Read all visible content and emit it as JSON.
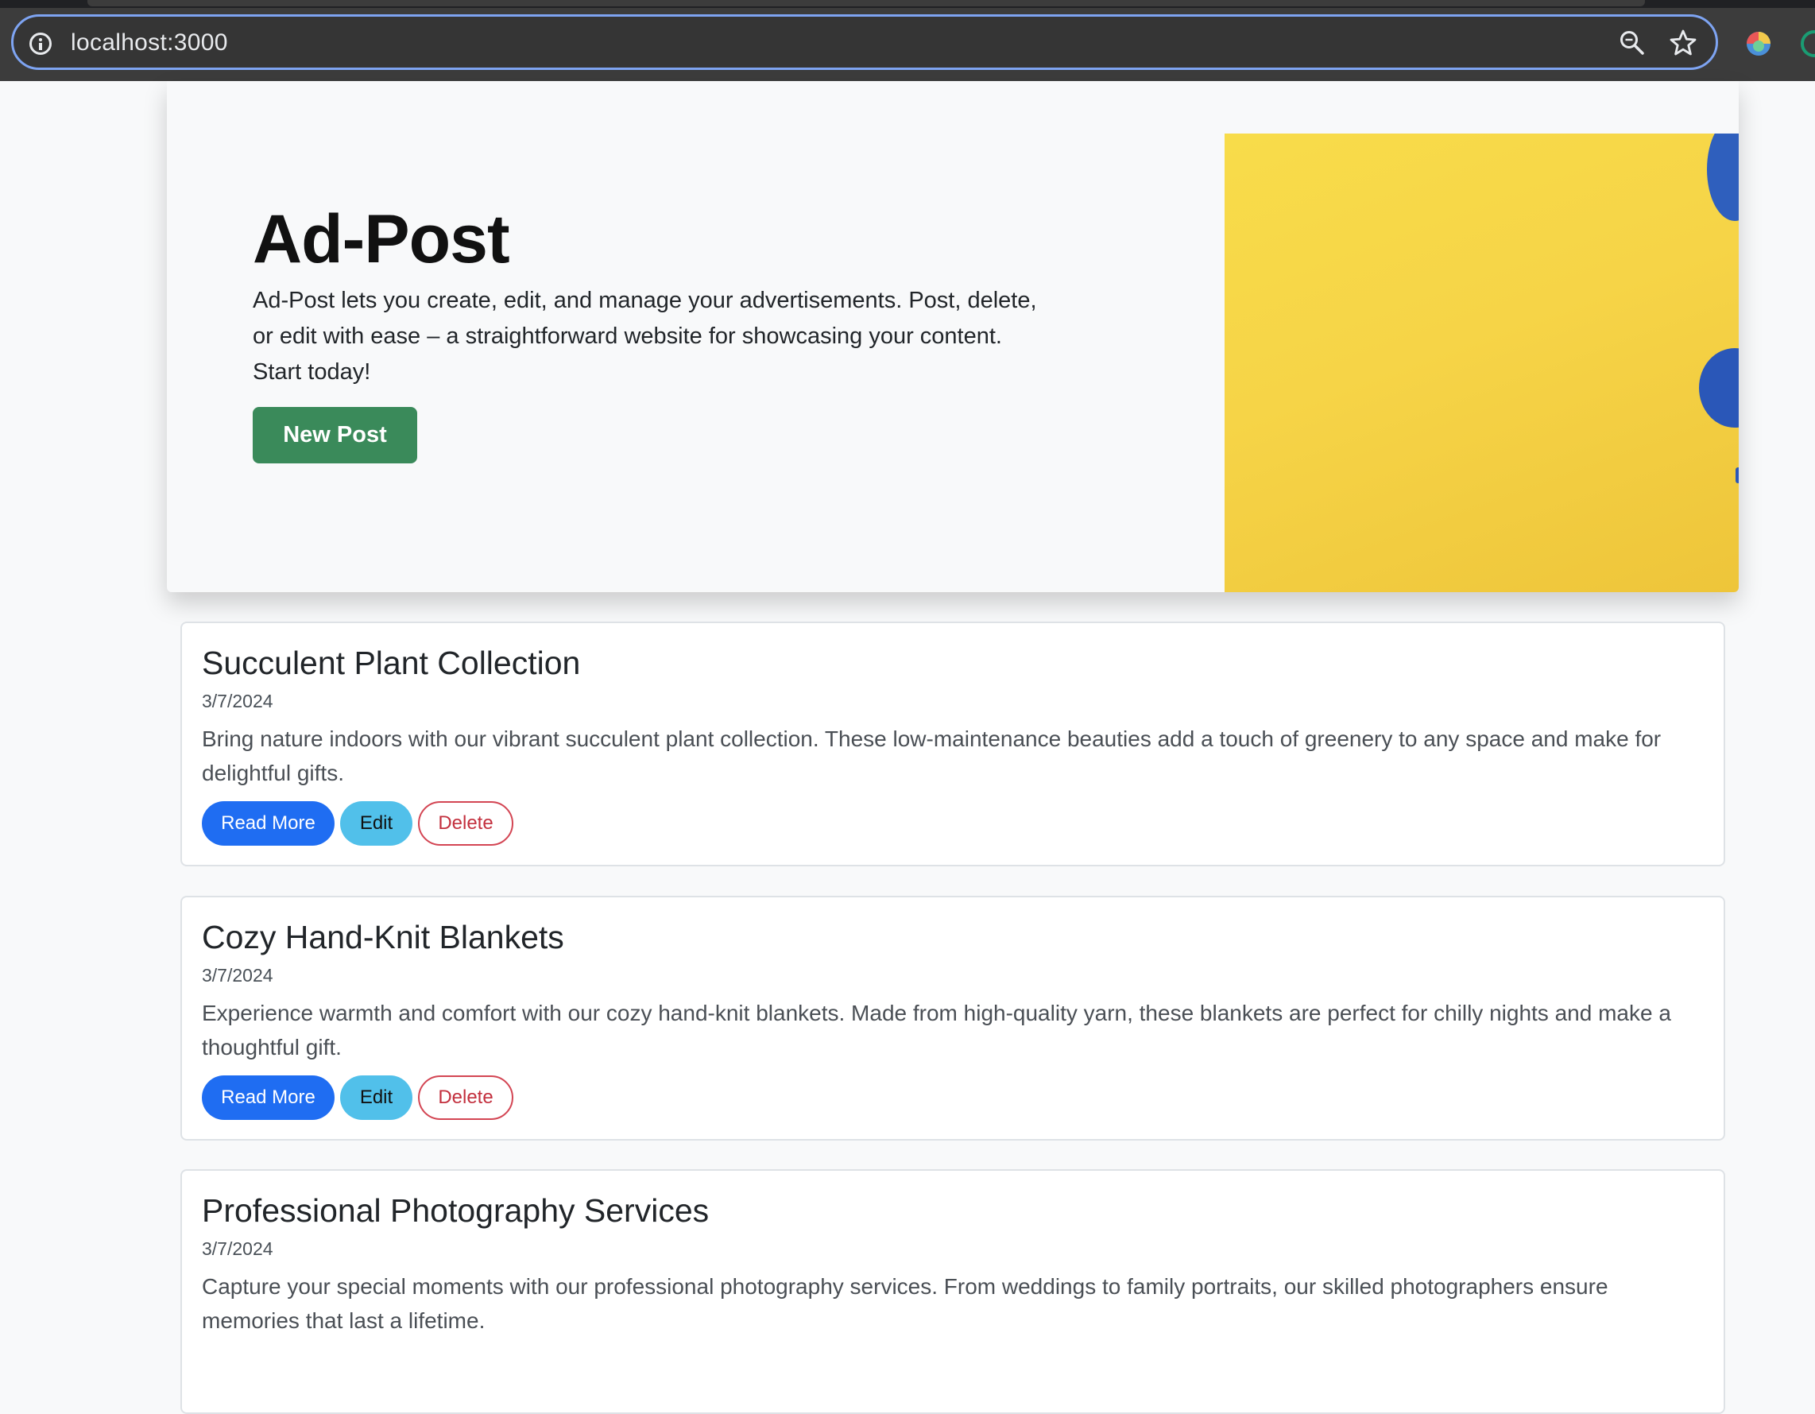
{
  "browser": {
    "url": "localhost:3000"
  },
  "hero": {
    "title": "Ad-Post",
    "lead": "Ad-Post lets you create, edit, and manage your advertisements. Post, delete, or edit with ease – a straightforward website for showcasing your content. Start today!",
    "new_post_label": "New Post"
  },
  "buttons": {
    "read_more": "Read More",
    "edit": "Edit",
    "delete": "Delete"
  },
  "posts": [
    {
      "title": "Succulent Plant Collection",
      "date": "3/7/2024",
      "text": "Bring nature indoors with our vibrant succulent plant collection. These low-maintenance beauties add a touch of greenery to any space and make for delightful gifts."
    },
    {
      "title": "Cozy Hand-Knit Blankets",
      "date": "3/7/2024",
      "text": "Experience warmth and comfort with our cozy hand-knit blankets. Made from high-quality yarn, these blankets are perfect for chilly nights and make a thoughtful gift."
    },
    {
      "title": "Professional Photography Services",
      "date": "3/7/2024",
      "text": "Capture your special moments with our professional photography services. From weddings to family portraits, our skilled photographers ensure memories that last a lifetime."
    }
  ]
}
